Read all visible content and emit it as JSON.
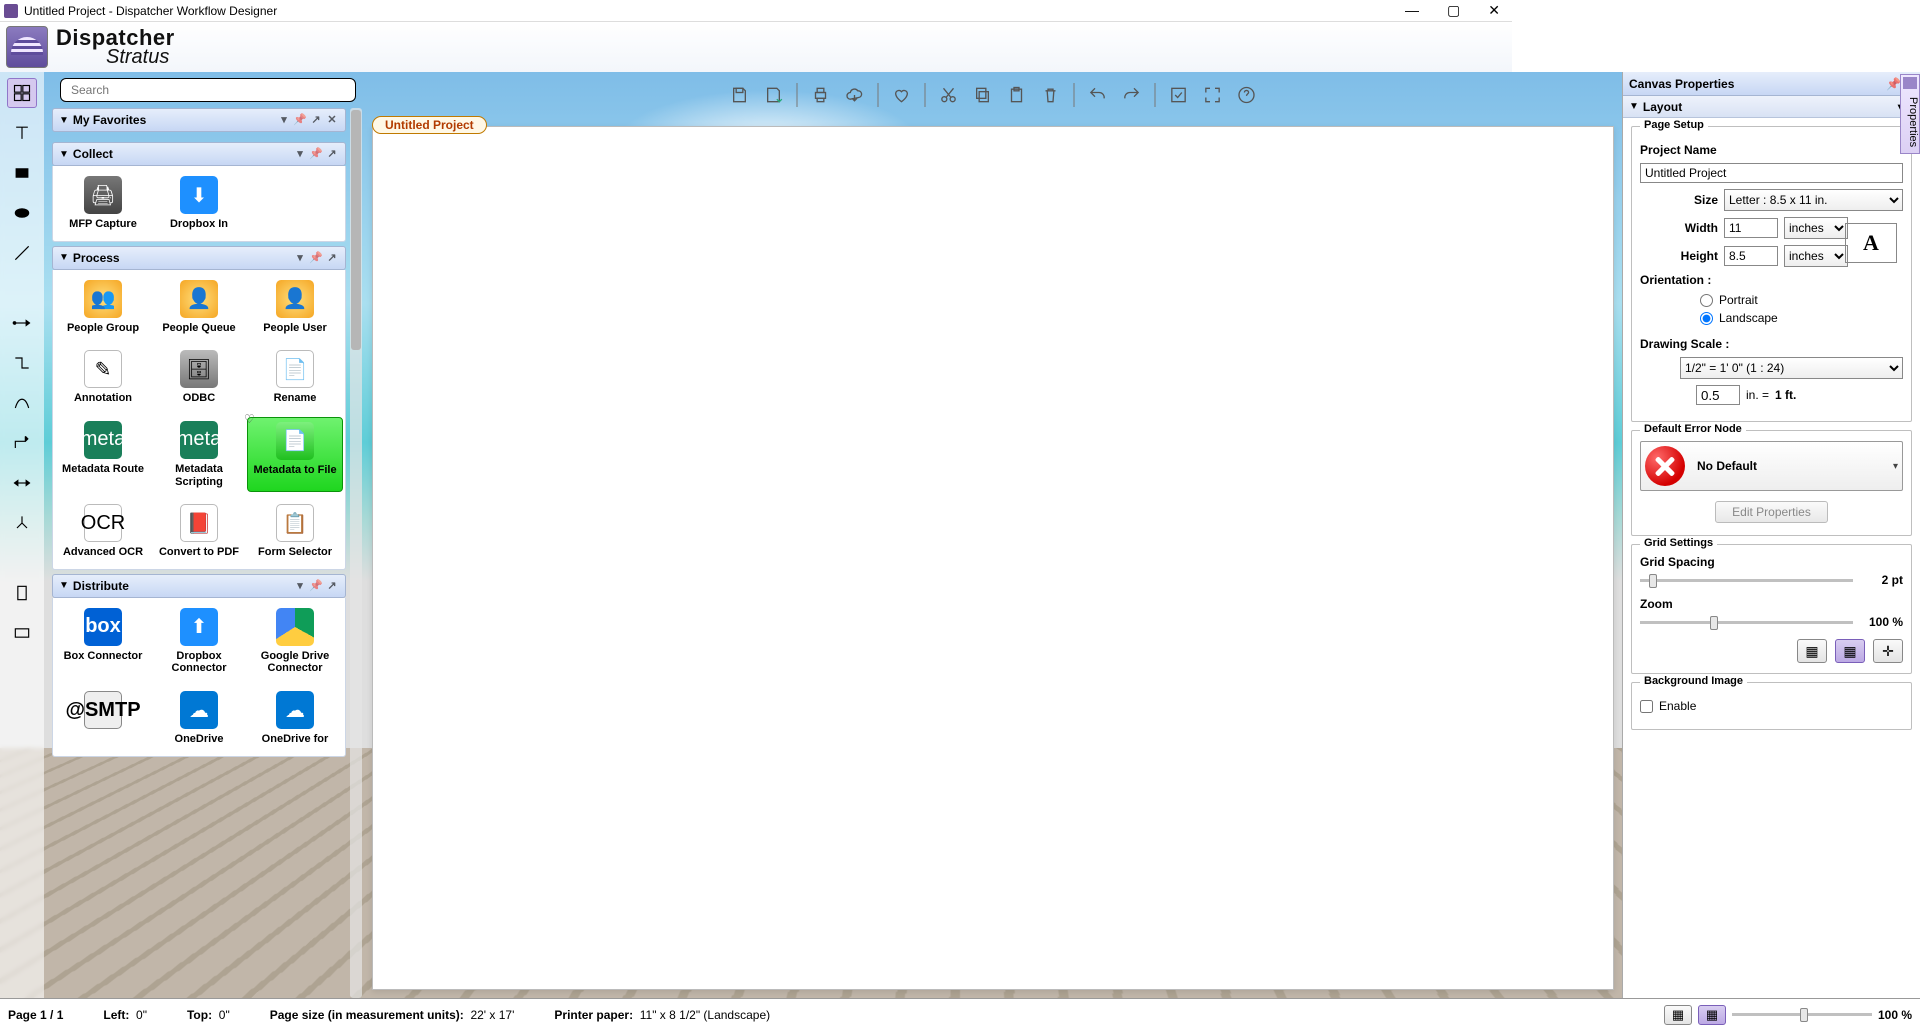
{
  "window": {
    "title": "Untitled Project - Dispatcher Workflow Designer"
  },
  "brand": {
    "line1": "Dispatcher",
    "line2": "Stratus"
  },
  "search": {
    "placeholder": "Search"
  },
  "canvas": {
    "tab_label": "Untitled Project"
  },
  "toolbar": {
    "save": "Save",
    "save_cloud": "Save to cloud",
    "print": "Print",
    "cloud": "Cloud",
    "favorite": "Favorite",
    "cut": "Cut",
    "copy": "Copy",
    "paste": "Paste",
    "delete": "Delete",
    "undo": "Undo",
    "redo": "Redo",
    "validate": "Validate",
    "fit": "Fit to screen",
    "help": "Help"
  },
  "categories": {
    "favorites": {
      "title": "My Favorites"
    },
    "collect": {
      "title": "Collect",
      "items": [
        {
          "label": "MFP Capture"
        },
        {
          "label": "Dropbox In"
        }
      ]
    },
    "process": {
      "title": "Process",
      "items": [
        {
          "label": "People Group"
        },
        {
          "label": "People Queue"
        },
        {
          "label": "People User"
        },
        {
          "label": "Annotation"
        },
        {
          "label": "ODBC"
        },
        {
          "label": "Rename"
        },
        {
          "label": "Metadata Route"
        },
        {
          "label": "Metadata Scripting"
        },
        {
          "label": "Metadata to File"
        },
        {
          "label": "Advanced OCR"
        },
        {
          "label": "Convert to PDF"
        },
        {
          "label": "Form Selector"
        }
      ]
    },
    "distribute": {
      "title": "Distribute",
      "items": [
        {
          "label": "Box Connector"
        },
        {
          "label": "Dropbox Connector"
        },
        {
          "label": "Google Drive Connector"
        },
        {
          "label": ""
        },
        {
          "label": "OneDrive"
        },
        {
          "label": "OneDrive for"
        }
      ]
    }
  },
  "props": {
    "panel_title": "Canvas Properties",
    "tab_title": "Properties",
    "layout_title": "Layout",
    "page_setup": {
      "legend": "Page Setup",
      "project_name_label": "Project Name",
      "project_name": "Untitled Project",
      "size_label": "Size",
      "size_value": "Letter :   8.5 x 11 in.",
      "width_label": "Width",
      "width": "11",
      "height_label": "Height",
      "height": "8.5",
      "unit": "inches",
      "orientation_label": "Orientation :",
      "portrait": "Portrait",
      "landscape": "Landscape",
      "orient_glyph": "A",
      "scale_label": "Drawing Scale :",
      "scale_preset": "1/2\" = 1' 0\" (1 : 24)",
      "scale_in": "0.5",
      "scale_text1": "in.  =",
      "scale_text2": "1 ft."
    },
    "error_node": {
      "legend": "Default Error Node",
      "value": "No Default",
      "edit_btn": "Edit Properties"
    },
    "grid": {
      "legend": "Grid Settings",
      "spacing_label": "Grid Spacing",
      "spacing_value": "2 pt",
      "zoom_label": "Zoom",
      "zoom_value": "100 %"
    },
    "bg": {
      "legend": "Background Image",
      "enable": "Enable"
    }
  },
  "status": {
    "page": "Page 1 / 1",
    "left_label": "Left:",
    "left_val": "0\"",
    "top_label": "Top:",
    "top_val": "0\"",
    "pagesize_label": "Page size (in measurement units):",
    "pagesize_val": "22' x 17'",
    "printer_label": "Printer paper:",
    "printer_val": "11\" x 8 1/2\"  (Landscape)",
    "zoom": "100 %"
  }
}
